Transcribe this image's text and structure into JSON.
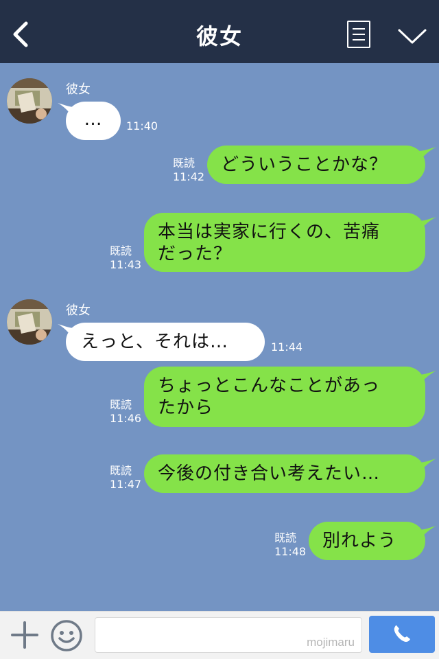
{
  "header": {
    "title": "彼女"
  },
  "messages": [
    {
      "from": "them",
      "sender": "彼女",
      "text": "…",
      "time": "11:40"
    },
    {
      "from": "me",
      "read": "既読",
      "time": "11:42",
      "text": "どういうことかな？"
    },
    {
      "from": "me",
      "read": "既読",
      "time": "11:43",
      "lines": [
        "本当は実家に行くの、苦痛",
        "だった？"
      ]
    },
    {
      "from": "them",
      "sender": "彼女",
      "text": "えっと、それは…",
      "time": "11:44"
    },
    {
      "from": "me",
      "read": "既読",
      "time": "11:46",
      "lines": [
        "ちょっとこんなことがあっ",
        "たから"
      ]
    },
    {
      "from": "me",
      "read": "既読",
      "time": "11:47",
      "text": "今後の付き合い考えたい…"
    },
    {
      "from": "me",
      "read": "既読",
      "time": "11:48",
      "text": "別れよう"
    }
  ],
  "footer": {
    "watermark": "mojimaru"
  },
  "colors": {
    "header_bg": "#243047",
    "chat_bg": "#7494c3",
    "bubble_out": "#85e249",
    "bubble_in": "#ffffff",
    "call_button": "#4e8de5"
  },
  "icons": [
    "back-icon",
    "menu-icon",
    "chevron-down-icon",
    "plus-icon",
    "emoji-icon",
    "phone-icon"
  ]
}
